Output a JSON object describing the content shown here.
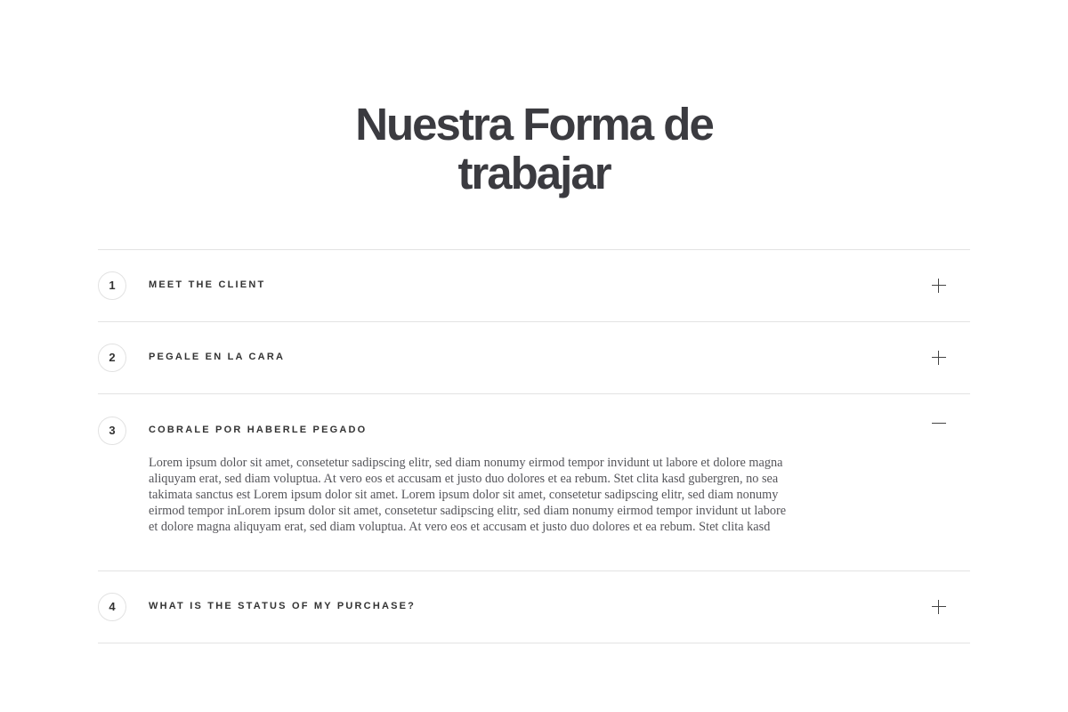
{
  "title": [
    "Nuestra Forma de",
    "trabajar"
  ],
  "accordion": [
    {
      "number": "1",
      "label": "MEET THE CLIENT",
      "expanded": false,
      "toggle_icon": "plus-icon"
    },
    {
      "number": "2",
      "label": "PEGALE EN LA CARA",
      "expanded": false,
      "toggle_icon": "plus-icon"
    },
    {
      "number": "3",
      "label": "COBRALE POR HABERLE PEGADO",
      "expanded": true,
      "toggle_icon": "minus-icon",
      "body_lines": [
        "Lorem ipsum dolor sit amet, consetetur sadipscing elitr, sed diam nonumy eirmod tempor invidunt ut labore et dolore magna",
        "aliquyam erat, sed diam voluptua. At vero eos et accusam et justo duo dolores et ea rebum. Stet clita kasd gubergren, no sea",
        "takimata sanctus est Lorem ipsum dolor sit amet. Lorem ipsum dolor sit amet, consetetur sadipscing elitr, sed diam nonumy",
        "eirmod tempor inLorem ipsum dolor sit amet, consetetur sadipscing elitr, sed diam nonumy eirmod tempor invidunt ut labore",
        "et dolore magna aliquyam erat, sed diam voluptua. At vero eos et accusam et justo duo dolores et ea rebum. Stet clita kasd"
      ]
    },
    {
      "number": "4",
      "label": "WHAT IS THE STATUS OF MY PURCHASE?",
      "expanded": false,
      "toggle_icon": "plus-icon"
    }
  ]
}
